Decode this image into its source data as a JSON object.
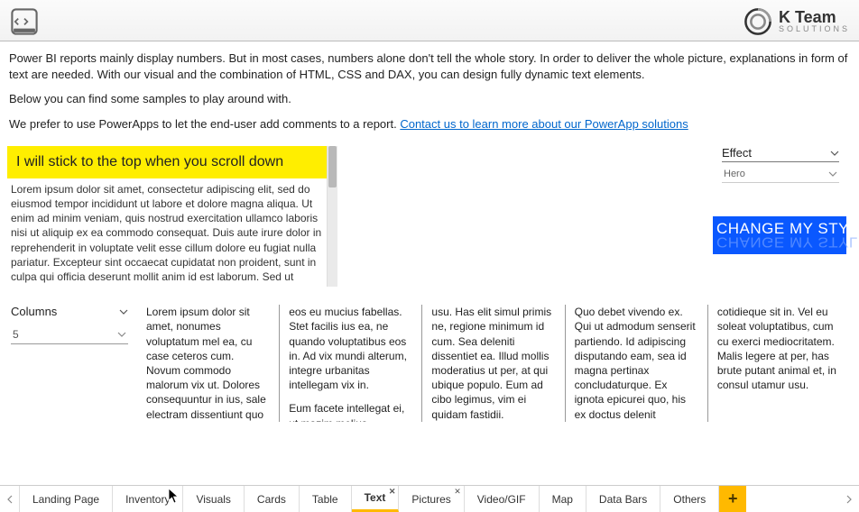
{
  "header": {
    "company_name": "K Team",
    "company_tag": "SOLUTIONS"
  },
  "intro": {
    "p1": "Power BI reports mainly display numbers. But in most cases, numbers alone don't tell the whole story. In order to deliver the whole picture, explanations in form of text are needed. With our visual and the combination of HTML, CSS and DAX, you can design fully dynamic text elements.",
    "p2": "Below you can find some samples to play around with.",
    "p3a": "We prefer to use PowerApps to let the end-user add comments to a report. ",
    "p3link": "Contact us to learn more about our PowerApp solutions"
  },
  "scroll_visual": {
    "banner": "I will stick to the top when you scroll down",
    "lorem": "Lorem ipsum dolor sit amet, consectetur adipiscing elit, sed do eiusmod tempor incididunt ut labore et dolore magna aliqua. Ut enim ad minim veniam, quis nostrud exercitation ullamco laboris nisi ut aliquip ex ea commodo consequat. Duis aute irure dolor in reprehenderit in voluptate velit esse cillum dolore eu fugiat nulla pariatur. Excepteur sint occaecat cupidatat non proident, sunt in culpa qui officia deserunt mollit anim id est laborum. Sed ut perspiciatis unde omnis iste natus error sit voluptatem accusantium doloremque laudantium, totam rem aperiam, eaque ipsa quae ab illo inventore veritatis et quasi architecto beatae vitae dicta sunt explicabo. Nemo enim ipsam voluptatem quia voluptas sit"
  },
  "effect": {
    "label": "Effect",
    "selected": "Hero"
  },
  "hero_text": "CHANGE MY STYLE",
  "columns_ctrl": {
    "label": "Columns",
    "value": "5"
  },
  "textcols": {
    "c0a": "Lorem ipsum dolor sit amet, nonumes voluptatum mel ea, cu case ceteros cum. Novum commodo malorum vix ut. Dolores consequuntur in ius, sale electram dissentiunt quo te. Cu duo omnes invidunt,",
    "c1a": "eos eu mucius fabellas. Stet facilis ius ea, ne quando voluptatibus eos in. Ad vix mundi alterum, integre urbanitas intellegam vix in.",
    "c1b": "Eum facete intellegat ei, ut mazim melius",
    "c2a": "usu. Has elit simul primis ne, regione minimum id cum. Sea deleniti dissentiet ea. Illud mollis moderatius ut per, at qui ubique populo. Eum ad cibo legimus, vim ei quidam fastidii.",
    "c3a": "Quo debet vivendo ex. Qui ut admodum senserit partiendo. Id adipiscing disputando eam, sea id magna pertinax concludaturque. Ex ignota epicurei quo, his ex doctus delenit fabellas, erat timeam",
    "c4a": "cotidieque sit in. Vel eu soleat voluptatibus, cum cu exerci mediocritatem. Malis legere at per, has brute putant animal et, in consul utamur usu."
  },
  "tabs": {
    "t0": "Landing Page",
    "t1": "Inventory",
    "t2": "Visuals",
    "t3": "Cards",
    "t4": "Table",
    "t5": "Text",
    "t6": "Pictures",
    "t7": "Video/GIF",
    "t8": "Map",
    "t9": "Data Bars",
    "t10": "Others",
    "add": "+"
  }
}
